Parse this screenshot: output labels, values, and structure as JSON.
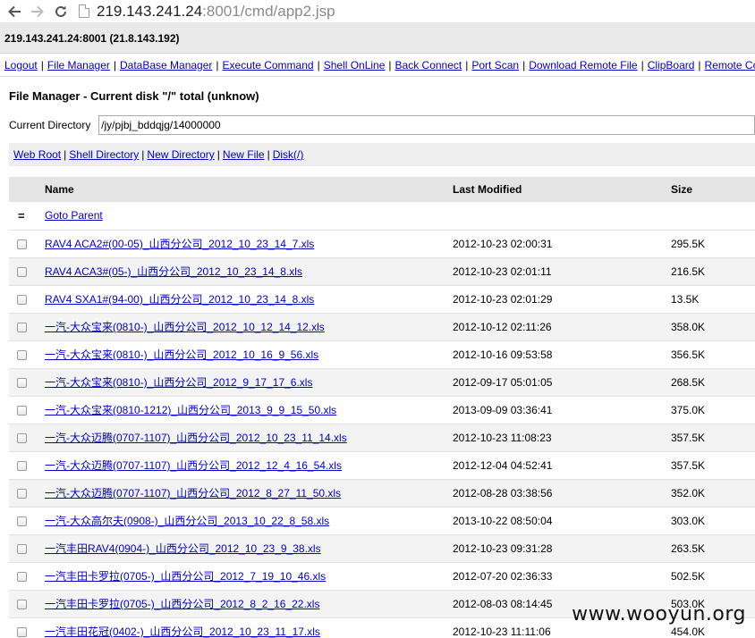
{
  "browser": {
    "host": "219.143.241.24",
    "path": ":8001/cmd/app2.jsp"
  },
  "server": {
    "label": "219.143.241.24:8001 (21.8.143.192)"
  },
  "menu": {
    "items": [
      {
        "label": "Logout"
      },
      {
        "label": "File Manager"
      },
      {
        "label": "DataBase Manager"
      },
      {
        "label": "Execute Command"
      },
      {
        "label": "Shell OnLine"
      },
      {
        "label": "Back Connect"
      },
      {
        "label": "Port Scan"
      },
      {
        "label": "Download Remote File"
      },
      {
        "label": "ClipBoard"
      },
      {
        "label": "Remote Co"
      }
    ],
    "separator": "|"
  },
  "file_manager": {
    "title": "File Manager - Current disk \"/\" total (unknow)",
    "current_dir_label": "Current Directory",
    "current_dir_value": "/jy/pjbj_bddqjg/14000000",
    "actions": [
      {
        "label": "Web Root"
      },
      {
        "label": "Shell Directory"
      },
      {
        "label": "New Directory"
      },
      {
        "label": "New File"
      },
      {
        "label": "Disk(/)"
      }
    ],
    "table": {
      "headers": {
        "name": "Name",
        "modified": "Last Modified",
        "size": "Size"
      },
      "parent": {
        "mark": "=",
        "label": "Goto Parent"
      },
      "rows": [
        {
          "name": "RAV4 ACA2#(00-05)_山西分公司_2012_10_23_14_7.xls",
          "modified": "2012-10-23 02:00:31",
          "size": "295.5K"
        },
        {
          "name": "RAV4 ACA3#(05-)_山西分公司_2012_10_23_14_8.xls",
          "modified": "2012-10-23 02:01:11",
          "size": "216.5K"
        },
        {
          "name": "RAV4 SXA1#(94-00)_山西分公司_2012_10_23_14_8.xls",
          "modified": "2012-10-23 02:01:29",
          "size": "13.5K"
        },
        {
          "name": "一汽-大众宝来(0810-)_山西分公司_2012_10_12_14_12.xls",
          "modified": "2012-10-12 02:11:26",
          "size": "358.0K"
        },
        {
          "name": "一汽-大众宝来(0810-)_山西分公司_2012_10_16_9_56.xls",
          "modified": "2012-10-16 09:53:58",
          "size": "356.5K"
        },
        {
          "name": "一汽-大众宝来(0810-)_山西分公司_2012_9_17_17_6.xls",
          "modified": "2012-09-17 05:01:05",
          "size": "268.5K"
        },
        {
          "name": "一汽-大众宝来(0810-1212)_山西分公司_2013_9_9_15_50.xls",
          "modified": "2013-09-09 03:36:41",
          "size": "375.0K"
        },
        {
          "name": "一汽-大众迈腾(0707-1107)_山西分公司_2012_10_23_11_14.xls",
          "modified": "2012-10-23 11:08:23",
          "size": "357.5K"
        },
        {
          "name": "一汽-大众迈腾(0707-1107)_山西分公司_2012_12_4_16_54.xls",
          "modified": "2012-12-04 04:52:41",
          "size": "357.5K"
        },
        {
          "name": "一汽-大众迈腾(0707-1107)_山西分公司_2012_8_27_11_50.xls",
          "modified": "2012-08-28 03:38:56",
          "size": "352.0K"
        },
        {
          "name": "一汽-大众高尔夫(0908-)_山西分公司_2013_10_22_8_58.xls",
          "modified": "2013-10-22 08:50:04",
          "size": "303.0K"
        },
        {
          "name": "一汽丰田RAV4(0904-)_山西分公司_2012_10_23_9_38.xls",
          "modified": "2012-10-23 09:31:28",
          "size": "263.5K"
        },
        {
          "name": "一汽丰田卡罗拉(0705-)_山西分公司_2012_7_19_10_46.xls",
          "modified": "2012-07-20 02:36:33",
          "size": "502.5K"
        },
        {
          "name": "一汽丰田卡罗拉(0705-)_山西分公司_2012_8_2_16_22.xls",
          "modified": "2012-08-03 08:14:45",
          "size": "503.0K"
        },
        {
          "name": "一汽丰田花冠(0402-)_山西分公司_2012_10_23_11_17.xls",
          "modified": "2012-10-23 11:11:06",
          "size": "454.0K"
        }
      ]
    }
  },
  "watermark": "www.wooyun.org",
  "icons": {
    "back": "back-arrow-icon",
    "forward": "forward-arrow-icon",
    "reload": "reload-icon",
    "page": "page-icon"
  },
  "colors": {
    "link": "#0000cc",
    "header_bg": "#e4e4e4",
    "server_bar_bg": "#e9e9e9"
  }
}
